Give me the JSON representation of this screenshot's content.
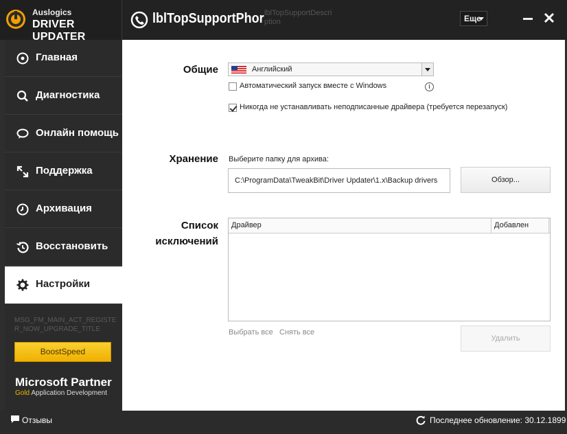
{
  "app": {
    "brand": "Auslogics",
    "name": "DRIVER UPDATER"
  },
  "header": {
    "support_phone": "lblTopSupportPhor",
    "support_desc": "lblTopSupportDescri ption",
    "more_label": "Еще"
  },
  "sidebar": {
    "items": [
      {
        "label": "Главная",
        "icon": "home-icon"
      },
      {
        "label": "Диагностика",
        "icon": "search-icon"
      },
      {
        "label": "Онлайн помощь",
        "icon": "chat-icon"
      },
      {
        "label": "Поддержка",
        "icon": "support-icon"
      },
      {
        "label": "Архивация",
        "icon": "clock-icon"
      },
      {
        "label": "Восстановить",
        "icon": "restore-icon"
      },
      {
        "label": "Настройки",
        "icon": "gear-icon"
      }
    ],
    "active_index": 6,
    "promo_text": "MSG_FM_MAIN_ACT_REGISTER_NOW_UPGRADE_TITLE",
    "boost_label": "BoostSpeed",
    "ms_partner": "Microsoft Partner",
    "ms_gold": "Gold",
    "ms_sub": "Application Development"
  },
  "settings": {
    "general_title": "Общие",
    "language": "Английский",
    "autostart_label": "Автоматический запуск вместе с Windows",
    "autostart_checked": false,
    "unsigned_label": "Никогда не устанавливать неподписанные драйвера (требуется перезапуск)",
    "unsigned_checked": true,
    "storage_title": "Хранение",
    "folder_label": "Выберите папку для архива:",
    "folder_path": "C:\\ProgramData\\TweakBit\\Driver Updater\\1.x\\Backup drivers",
    "browse_label": "Обзор...",
    "exclusions_title_1": "Список",
    "exclusions_title_2": "исключений",
    "columns": [
      "Драйвер",
      "Добавлен"
    ],
    "select_all": "Выбрать все",
    "deselect_all": "Снять все",
    "delete_label": "Удалить"
  },
  "status": {
    "feedback": "Отзывы",
    "last_update": "Последнее обновление: 30.12.1899"
  },
  "colors": {
    "accent": "#f0b000",
    "dark": "#2b2b2b"
  }
}
